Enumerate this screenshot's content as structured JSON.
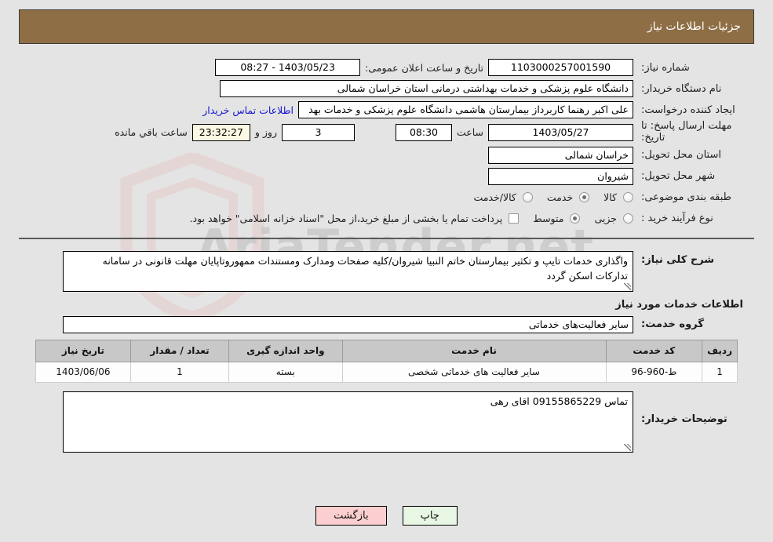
{
  "header": {
    "title": "جزئیات اطلاعات نیاز"
  },
  "form": {
    "need_number": {
      "label": "شماره نیاز:",
      "value": "1103000257001590"
    },
    "public_announce": {
      "label": "تاریخ و ساعت اعلان عمومی:",
      "value": "1403/05/23 - 08:27"
    },
    "buyer_org": {
      "label": "نام دستگاه خریدار:",
      "value": "دانشگاه علوم پزشکی و خدمات بهداشتی درمانی استان خراسان شمالی"
    },
    "creator": {
      "label": "ایجاد کننده درخواست:",
      "value": "علی اکبر رهنما کاربرداز بیمارستان هاشمی دانشگاه علوم پزشکی و خدمات بهد"
    },
    "contact_link": "اطلاعات تماس خریدار",
    "deadline": {
      "label_line1": "مهلت ارسال پاسخ: تا",
      "label_line2": "تاریخ:",
      "date": "1403/05/27",
      "time_label": "ساعت",
      "time": "08:30",
      "days": "3",
      "days_label": "روز و",
      "remaining": "23:32:27",
      "remaining_label": "ساعت باقي مانده"
    },
    "province": {
      "label": "استان محل تحویل:",
      "value": "خراسان شمالی"
    },
    "city": {
      "label": "شهر محل تحویل:",
      "value": "شیروان"
    },
    "category": {
      "label": "طبقه بندی موضوعی:",
      "options": [
        "کالا",
        "خدمت",
        "کالا/خدمت"
      ],
      "selected": "خدمت"
    },
    "purchase_type": {
      "label": "نوع فرآیند خرید :",
      "options": [
        "جزیی",
        "متوسط"
      ],
      "selected": "متوسط",
      "checkbox_label": "پرداخت تمام یا بخشی از مبلغ خرید،از محل \"اسناد خزانه اسلامی\" خواهد بود.",
      "checkbox_checked": false
    }
  },
  "description": {
    "label": "شرح کلی نیاز:",
    "value": "واگذاری خدمات تایپ و تکثیر بیمارستان خاتم النبیا شیروان/کلیه صفحات ومدارک ومستندات ممهوروتاپایان مهلت قانونی در سامانه تدارکات اسکن گردد"
  },
  "services_section": {
    "heading": "اطلاعات خدمات مورد نیاز",
    "group_label": "گروه خدمت:",
    "group_value": "سایر فعالیت‌های خدماتی"
  },
  "table": {
    "columns": [
      "ردیف",
      "کد خدمت",
      "نام خدمت",
      "واحد اندازه گیری",
      "تعداد / مقدار",
      "تاریخ نیاز"
    ],
    "rows": [
      [
        "1",
        "ط-960-96",
        "سایر فعالیت های خدماتی شخصی",
        "بسته",
        "1",
        "1403/06/06"
      ]
    ]
  },
  "buyer_notes": {
    "label": "توضیحات خریدار:",
    "value": "تماس 09155865229 اقای رهی"
  },
  "buttons": {
    "print": "چاپ",
    "back": "بازگشت"
  },
  "watermark": {
    "text": "AriaTender.net"
  },
  "colors": {
    "header_bg": "#8e6e45",
    "page_bg": "#e4e4e4",
    "link": "#1414d2",
    "gold_label": "#8a6a33",
    "print_btn": "#e8f6e4",
    "back_btn": "#fbcfcf",
    "cream_field": "#fbf8e3"
  }
}
